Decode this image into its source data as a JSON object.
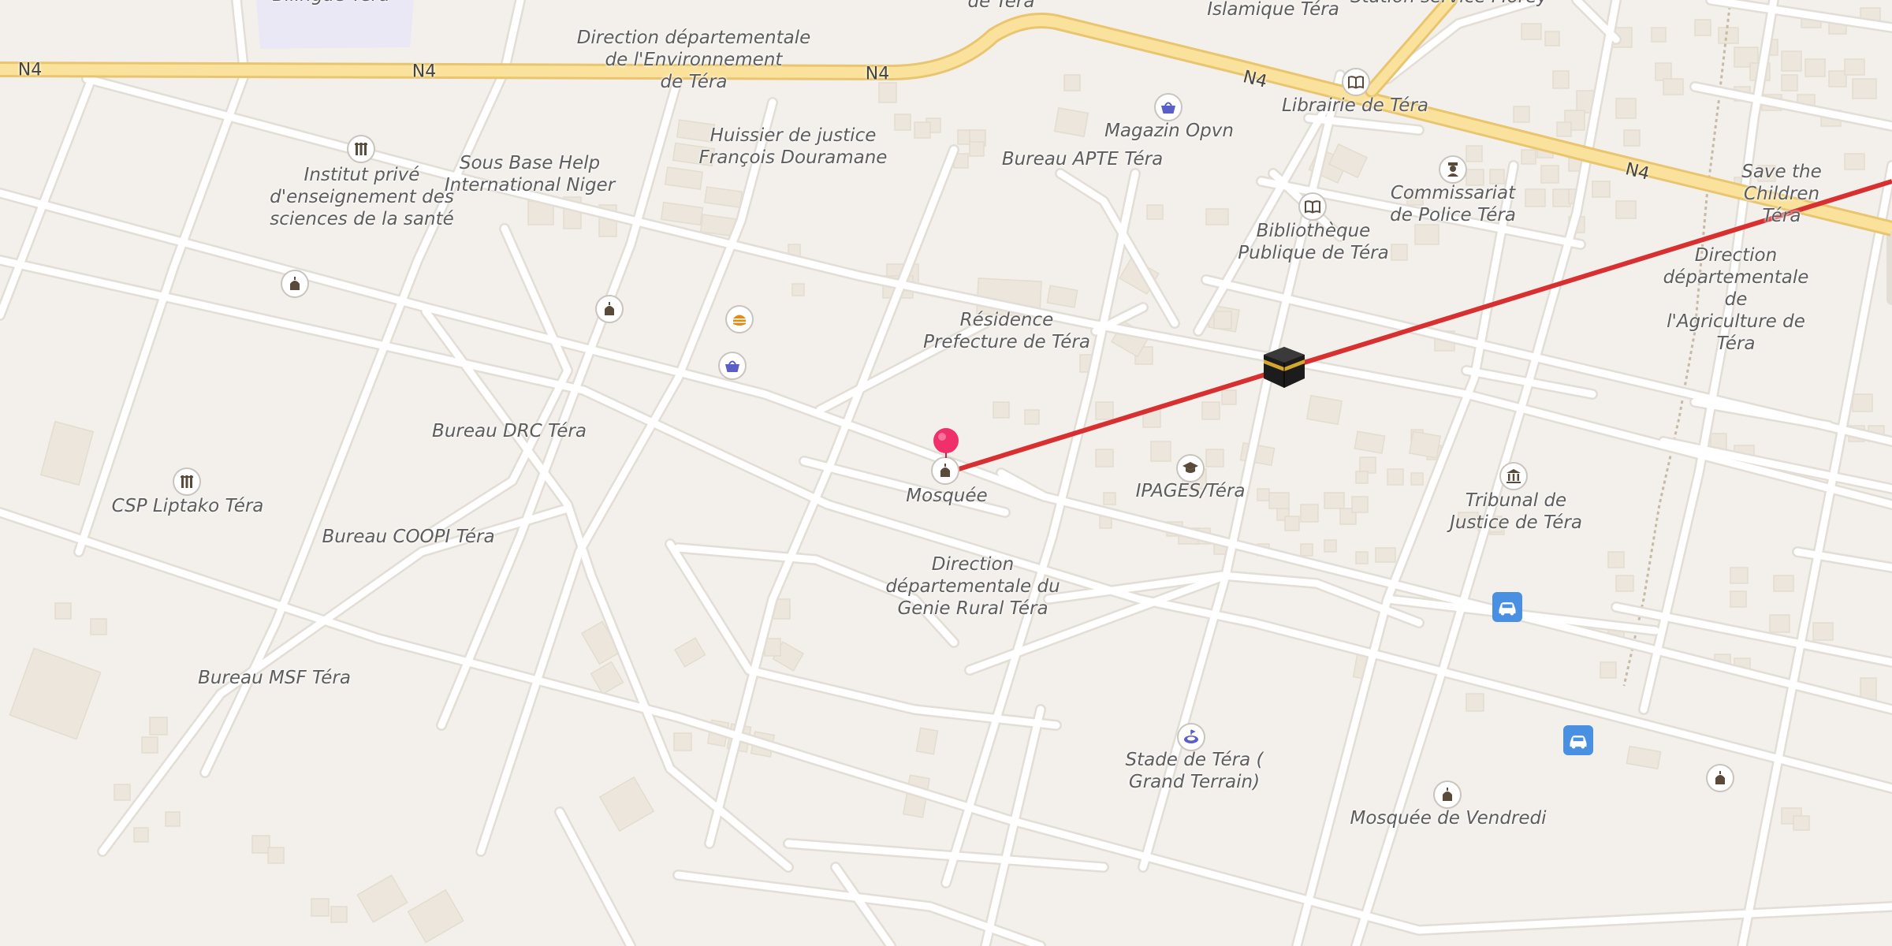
{
  "roads": {
    "n4_label": "N4"
  },
  "labels": {
    "dir_env": "Direction départementale\nde l'Environnement\nde Téra",
    "huissier": "Huissier de justice\nFrançois Douramane",
    "sous_base": "Sous Base Help\nInternational Niger",
    "institut": "Institut privé\nd'enseignement des\nsciences de la santé",
    "bureau_apte": "Bureau APTE Téra",
    "magazin": "Magazin Opvn",
    "librairie": "Librairie de Téra",
    "islamique": "Islamique Téra",
    "station": "Station service Morey",
    "de_tera_top": "de Téra",
    "bilingue": "Bilingue Téra",
    "commissariat": "Commissariat\nde Police Téra",
    "bibliotheque": "Bibliothèque\nPublique de Téra",
    "save": "Save the\nChildren Téra",
    "dir_agri": "Direction\ndépartementale de\nl'Agriculture de Téra",
    "residence": "Résidence\nPrefecture de Téra",
    "bureau_drc": "Bureau DRC Téra",
    "csp": "CSP Liptako Téra",
    "bureau_coopi": "Bureau COOPI Téra",
    "mosquee": "Mosquée",
    "ipages": "IPAGES/Téra",
    "tribunal": "Tribunal de\nJustice de Téra",
    "dir_genie": "Direction\ndépartementale du\nGenie Rural Téra",
    "bureau_msf": "Bureau MSF Téra",
    "stade": "Stade de Téra (\nGrand Terrain)",
    "mosquee_vendredi": "Mosquée de Vendredi"
  },
  "icons": {
    "school": "school-icon",
    "shop": "shopping-basket-icon",
    "book": "book-icon",
    "police": "police-icon",
    "mosque": "mosque-icon",
    "fast_food": "burger-icon",
    "graduation": "graduation-cap-icon",
    "courthouse": "courthouse-icon",
    "stadium": "stadium-icon",
    "car": "car-icon",
    "pin": "location-pin-icon",
    "qibla": "kaaba-icon"
  },
  "colors": {
    "background": "#f3f0ec",
    "road": "#ffffff",
    "road_edge": "#e2ddd5",
    "primary_road": "#fbe29c",
    "primary_road_edge": "#e8c56e",
    "building": "#ece6dc",
    "qibla_line": "#d83030",
    "pin": "#f0306a",
    "car_badge": "#4a90e2",
    "shop_icon": "#5a5fc8",
    "food_icon": "#e38a12"
  }
}
